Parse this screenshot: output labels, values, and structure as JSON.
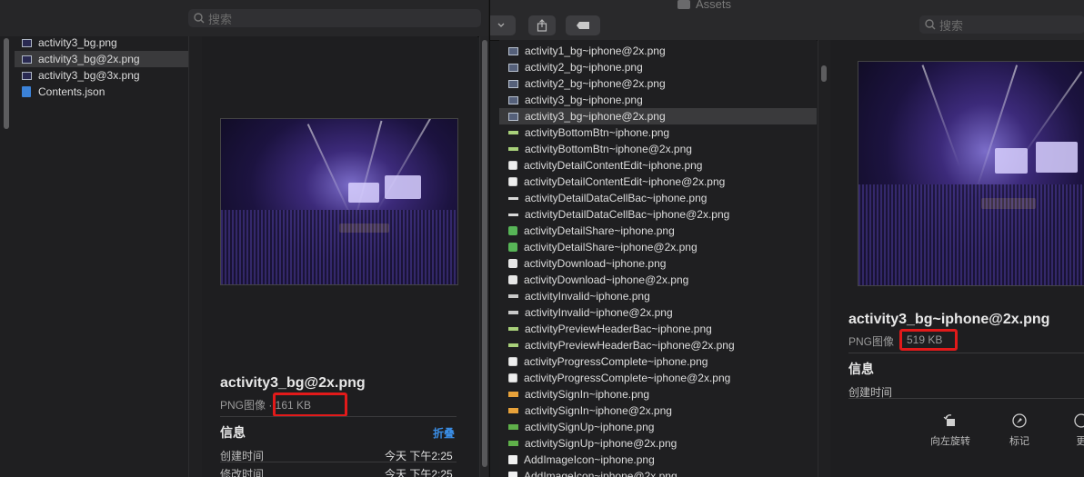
{
  "left": {
    "search_placeholder": "搜索",
    "files": [
      {
        "name": "activity3_bg.png",
        "kind": "image",
        "selected": false
      },
      {
        "name": "activity3_bg@2x.png",
        "kind": "image",
        "selected": true
      },
      {
        "name": "activity3_bg@3x.png",
        "kind": "image",
        "selected": false
      },
      {
        "name": "Contents.json",
        "kind": "json",
        "selected": false
      }
    ],
    "preview": {
      "file_name": "activity3_bg@2x.png",
      "file_type": "PNG图像 · ",
      "file_size": "161 KB",
      "info_title": "信息",
      "collapse_label": "折叠",
      "rows": [
        {
          "key": "创建时间",
          "value": "今天 下午2:25"
        },
        {
          "key": "修改时间",
          "value": "今天 下午2:25"
        }
      ]
    }
  },
  "right": {
    "window_title": "Assets",
    "search_placeholder": "搜索",
    "files": [
      {
        "name": "activity1_bg~iphone@2x.png",
        "icon": "img"
      },
      {
        "name": "activity2_bg~iphone.png",
        "icon": "img"
      },
      {
        "name": "activity2_bg~iphone@2x.png",
        "icon": "img"
      },
      {
        "name": "activity3_bg~iphone.png",
        "icon": "img"
      },
      {
        "name": "activity3_bg~iphone@2x.png",
        "icon": "img",
        "selected": true
      },
      {
        "name": "activityBottomBtn~iphone.png",
        "icon": "barg"
      },
      {
        "name": "activityBottomBtn~iphone@2x.png",
        "icon": "barg"
      },
      {
        "name": "activityDetailContentEdit~iphone.png",
        "icon": "edit"
      },
      {
        "name": "activityDetailContentEdit~iphone@2x.png",
        "icon": "edit"
      },
      {
        "name": "activityDetailDataCellBac~iphone.png",
        "icon": "line"
      },
      {
        "name": "activityDetailDataCellBac~iphone@2x.png",
        "icon": "line"
      },
      {
        "name": "activityDetailShare~iphone.png",
        "icon": "green"
      },
      {
        "name": "activityDetailShare~iphone@2x.png",
        "icon": "green"
      },
      {
        "name": "activityDownload~iphone.png",
        "icon": "dl"
      },
      {
        "name": "activityDownload~iphone@2x.png",
        "icon": "dl"
      },
      {
        "name": "activityInvalid~iphone.png",
        "icon": "bar"
      },
      {
        "name": "activityInvalid~iphone@2x.png",
        "icon": "bar"
      },
      {
        "name": "activityPreviewHeaderBac~iphone.png",
        "icon": "barg"
      },
      {
        "name": "activityPreviewHeaderBac~iphone@2x.png",
        "icon": "barg"
      },
      {
        "name": "activityProgressComplete~iphone.png",
        "icon": "edit"
      },
      {
        "name": "activityProgressComplete~iphone@2x.png",
        "icon": "edit"
      },
      {
        "name": "activitySignIn~iphone.png",
        "icon": "orange"
      },
      {
        "name": "activitySignIn~iphone@2x.png",
        "icon": "orange"
      },
      {
        "name": "activitySignUp~iphone.png",
        "icon": "gbar"
      },
      {
        "name": "activitySignUp~iphone@2x.png",
        "icon": "gbar"
      },
      {
        "name": "AddImageIcon~iphone.png",
        "icon": "white"
      },
      {
        "name": "AddImageIcon~iphone@2x.png",
        "icon": "white"
      }
    ],
    "preview": {
      "file_name": "activity3_bg~iphone@2x.png",
      "file_type": "PNG图像",
      "file_size": "519 KB",
      "info_title": "信息",
      "created_label": "创建时间"
    },
    "actions": {
      "rotate_left": "向左旋转",
      "markup": "标记",
      "more": "更"
    }
  },
  "colors": {
    "highlight_red": "#e21a1a",
    "link_blue": "#3a8ee6"
  }
}
